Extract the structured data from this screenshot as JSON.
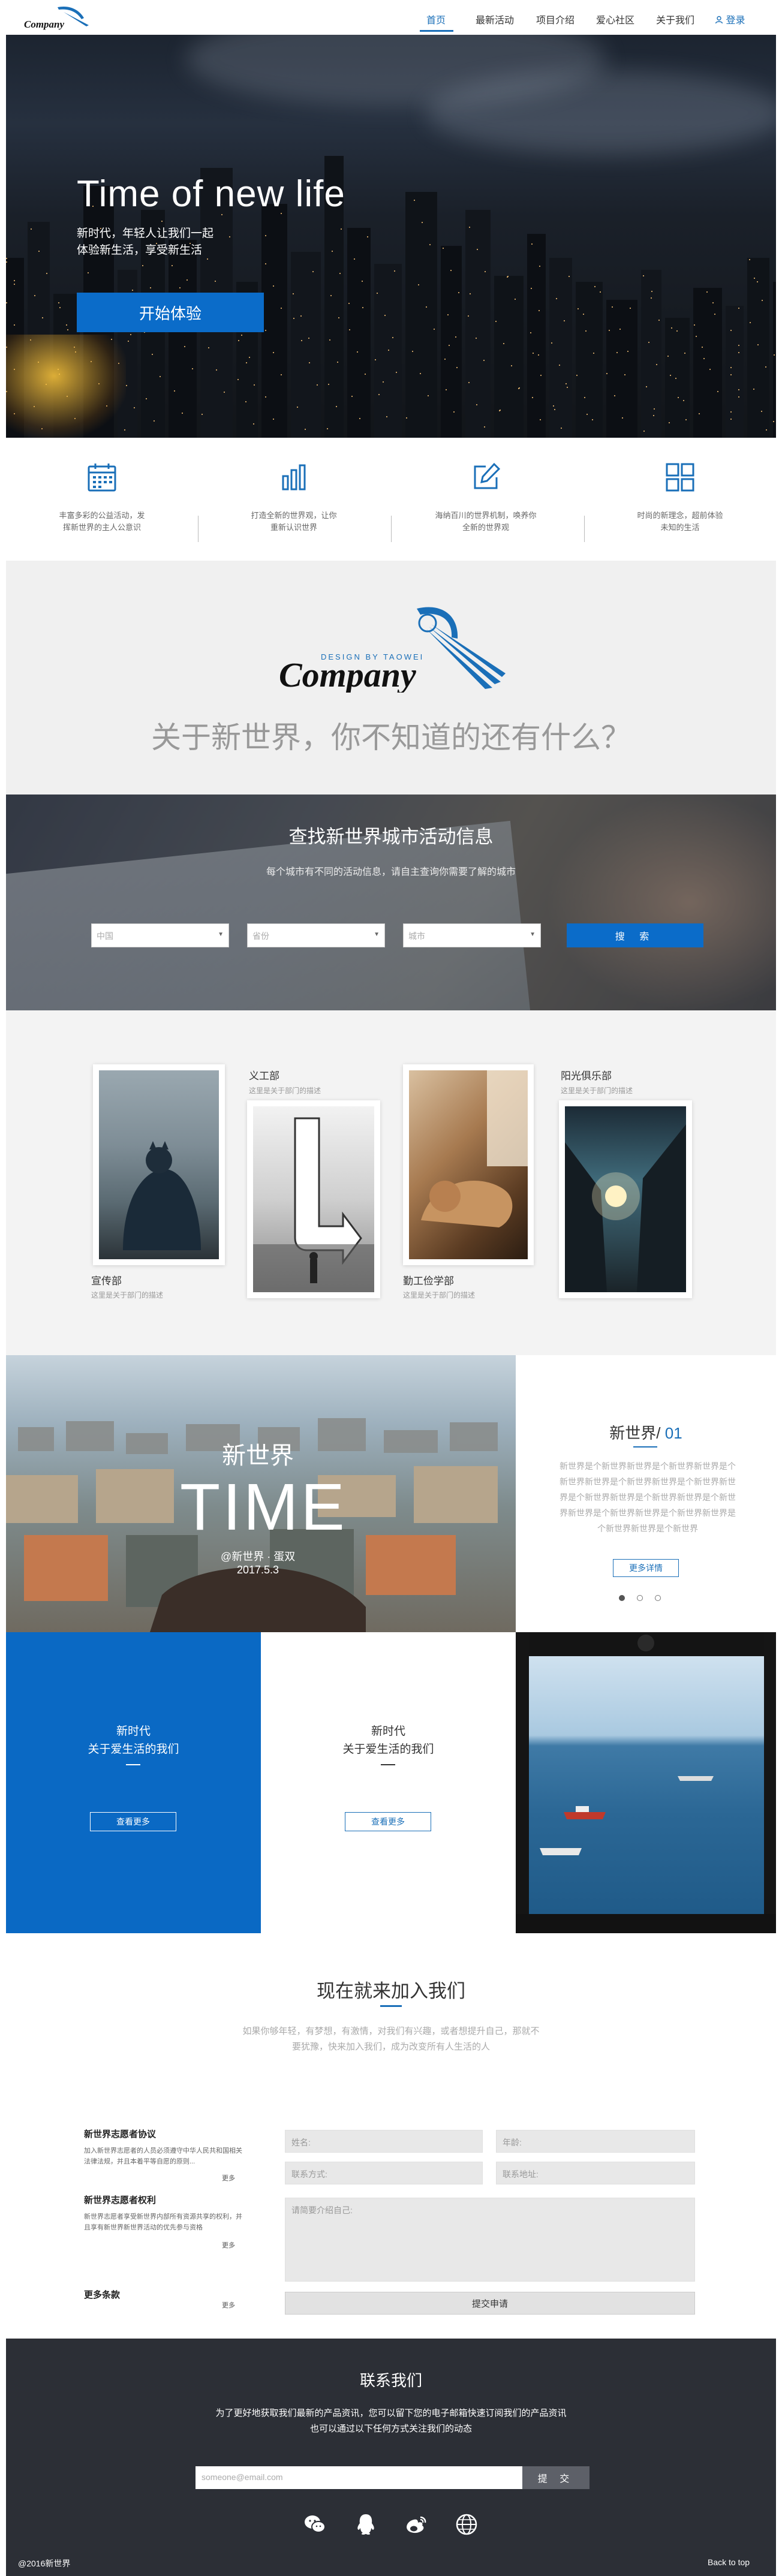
{
  "header": {
    "logo_text": "Company",
    "nav": [
      "首页",
      "最新活动",
      "项目介绍",
      "爱心社区",
      "关于我们"
    ],
    "login": "登录"
  },
  "hero": {
    "title": "Time of new life",
    "sub1": "新时代，年轻人让我们一起",
    "sub2": "体验新生活，享受新生活",
    "button": "开始体验"
  },
  "features": [
    {
      "icon": "calendar-icon",
      "line1": "丰富多彩的公益活动，发",
      "line2": "挥新世界的主人公意识"
    },
    {
      "icon": "bar-chart-icon",
      "line1": "打造全新的世界观，让你",
      "line2": "重新认识世界"
    },
    {
      "icon": "edit-icon",
      "line1": "海纳百川的世界机制，唤养你",
      "line2": "全新的世界观"
    },
    {
      "icon": "grid-icon",
      "line1": "时尚的新理念，超前体验",
      "line2": "未知的生活"
    }
  ],
  "about": {
    "logo_tagline": "DESIGN BY TAOWEI",
    "logo_text": "Company",
    "title": "关于新世界，你不知道的还有什么？"
  },
  "search": {
    "title": "查找新世界城市活动信息",
    "subtitle": "每个城市有不同的活动信息，请自主查询你需要了解的城市",
    "selects": [
      "中国",
      "省份",
      "城市"
    ],
    "button": "搜 索"
  },
  "gallery": [
    {
      "title": "宣传部",
      "desc": "这里是关于部门的描述"
    },
    {
      "title": "义工部",
      "desc": "这里是关于部门的描述"
    },
    {
      "title": "勤工俭学部",
      "desc": "这里是关于部门的描述"
    },
    {
      "title": "阳光俱乐部",
      "desc": "这里是关于部门的描述"
    }
  ],
  "slide": {
    "overlay_title": "新世界",
    "overlay_big": "TIME",
    "overlay_by": "@新世界 · 蛋双",
    "overlay_date": "2017.5.3",
    "heading": "新世界/",
    "number": "01",
    "body": "新世界是个新世界新世界是个新世界新世界是个新世界新世界是个新世界新世界是个新世界新世界是个新世界新世界是个新世界新世界是个新世界新世界是个新世界新世界是个新世界新世界是个新世界新世界是个新世界",
    "button": "更多详情"
  },
  "panels": {
    "blue": {
      "line1": "新时代",
      "line2": "关于爱生活的我们",
      "button": "查看更多"
    },
    "white": {
      "line1": "新时代",
      "line2": "关于爱生活的我们",
      "button": "查看更多"
    }
  },
  "join": {
    "title": "现在就来加入我们",
    "subtitle": "如果你够年轻，有梦想，有激情，对我们有兴趣，或者想提升自己，那就不要犹豫，快来加入我们，成为改变所有人生活的人"
  },
  "agreements": [
    {
      "title": "新世界志愿者协议",
      "text": "加入新世界志愿者的人员必须遵守中华人民共和国相关法律法规，并且本着平等自愿的原则...",
      "more": "更多"
    },
    {
      "title": "新世界志愿者权利",
      "text": "新世界志愿者享受新世界内部所有资源共享的权利，并且享有新世界新世界活动的优先参与资格",
      "more": "更多"
    },
    {
      "title": "更多条款",
      "text": "",
      "more": "更多"
    }
  ],
  "form": {
    "name": "姓名:",
    "age": "年龄:",
    "phone": "联系方式:",
    "address": "联系地址:",
    "intro": "请简要介绍自己:",
    "submit": "提交申请"
  },
  "contact": {
    "title": "联系我们",
    "line1": "为了更好地获取我们最新的产品资讯，您可以留下您的电子邮箱快速订阅我们的产品资讯",
    "line2": "也可以通过以下任何方式关注我们的动态",
    "email_placeholder": "someone@email.com",
    "submit": "提 交",
    "social": [
      "wechat-icon",
      "qq-icon",
      "weibo-icon",
      "globe-icon"
    ]
  },
  "footer": {
    "copyright": "@2016新世界",
    "back_top": "Back to top"
  },
  "colors": {
    "accent": "#0b6cc9",
    "dark_footer": "#2c2f36"
  }
}
